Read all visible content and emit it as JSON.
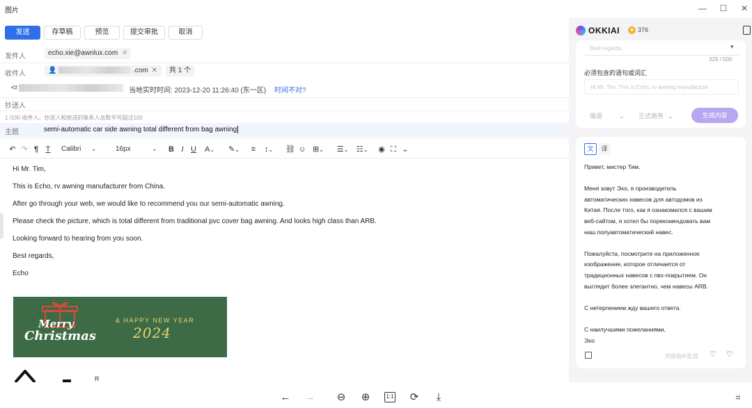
{
  "window": {
    "title": "图片"
  },
  "toolbar": {
    "send": "发送",
    "draft": "存草稿",
    "preview": "预览",
    "submit": "提交审批",
    "cancel": "取消"
  },
  "fields": {
    "from_label": "发件人",
    "from_value": "echo.xie@awnlux.com",
    "to_label": "收件人",
    "to_suffix": ".com",
    "to_count": "共 1 个",
    "local_prefix": "<r",
    "local_time": "当地实时时间: 2023-12-20 11:26:40 (东一区)",
    "time_wrong": "时间不对?",
    "cc_label": "抄送人",
    "limit_note": "1 /100 收件人、抄送人和密送的联系人总数不可超过100",
    "subject_label": "主题",
    "subject_value": "semi-automatic car side awning total different from bag awning"
  },
  "editor": {
    "font": "Calibri",
    "size": "16px"
  },
  "body_lines": [
    "Hi Mr. Tim,",
    "This is Echo, rv awning manufacturer from China.",
    "After go through your web, we would like to recommend you our semi-automatic awning.",
    "Please check the picture,  which is total different from traditional pvc cover bag awning. And looks high class than ARB.",
    "Looking forward to hearing from you soon.",
    "Best regards,",
    "Echo"
  ],
  "banner": {
    "merry": "Merry",
    "christmas": "Christmas",
    "happy": "& HAPPY NEW YEAR",
    "year": "2024"
  },
  "logo_mark": "R",
  "assistant": {
    "brand": "OKKIAI",
    "credits": "376",
    "regards_placeholder": "Best regards,",
    "char_count": "329 / 500",
    "must_include_label": "必须包含的语句或词汇",
    "must_include_placeholder": "Hi Mr. Tim, This is Echo, rv awning manufacture",
    "lang": "俄语",
    "tone": "正式商务",
    "generate": "生成内容",
    "tab_text": "文",
    "tab_translate": "译",
    "result_lines": [
      "Привет, мистер Тим,",
      "",
      "Меня зовут Эхо, я производитель",
      "автоматических навесов для автодомов из",
      "Китая. После того, как я ознакомился с вашим",
      "веб-сайтом, я хотел бы порекомендовать вам",
      "наш полуавтоматический навес.",
      "",
      "Пожалуйста, посмотрите на приложенное",
      "изображение, которое отличается от",
      "традиционных навесов с пвх-покрытием. Он",
      "выглядит более элегантно, чем навесы ARB.",
      "",
      "С нетерпением жду вашего ответа.",
      "",
      "С наилучшими пожеланиями,",
      "Эхо"
    ],
    "ai_note": "内容由AI生成"
  },
  "colors": {
    "primary": "#2f6fe8",
    "accent_purple": "#b9a6f0",
    "banner_green": "#3d6b45",
    "banner_gold": "#e8d47a"
  }
}
